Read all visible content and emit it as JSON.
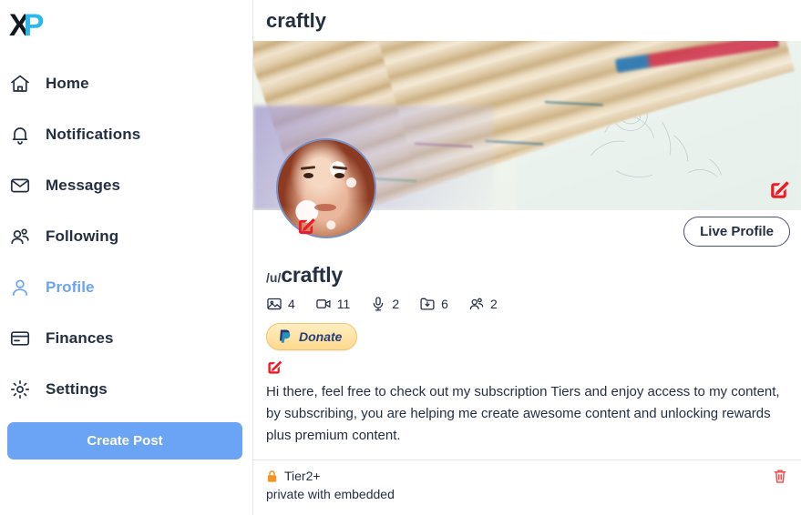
{
  "sidebar": {
    "logo": {
      "part1": "X",
      "part2": "P",
      "name": "xp-logo"
    },
    "items": [
      {
        "label": "Home",
        "icon": "home-icon",
        "active": false
      },
      {
        "label": "Notifications",
        "icon": "bell-icon",
        "active": false
      },
      {
        "label": "Messages",
        "icon": "envelope-icon",
        "active": false
      },
      {
        "label": "Following",
        "icon": "users-icon",
        "active": false
      },
      {
        "label": "Profile",
        "icon": "user-icon",
        "active": true
      },
      {
        "label": "Finances",
        "icon": "credit-card-icon",
        "active": false
      },
      {
        "label": "Settings",
        "icon": "gear-icon",
        "active": false
      }
    ],
    "create_post_label": "Create Post"
  },
  "header": {
    "title": "craftly"
  },
  "banner": {
    "edit_icon": "edit-square-icon",
    "description": "colored pencils on sketch pad"
  },
  "avatar": {
    "edit_icon": "edit-square-icon",
    "description": "portrait of woman with red hair"
  },
  "actions": {
    "live_profile_label": "Live Profile"
  },
  "profile": {
    "handle_prefix": "/u/",
    "handle_name": "craftly",
    "stats": [
      {
        "icon": "image-icon",
        "value": "4"
      },
      {
        "icon": "video-camera-icon",
        "value": "11"
      },
      {
        "icon": "microphone-icon",
        "value": "2"
      },
      {
        "icon": "folder-download-icon",
        "value": "6"
      },
      {
        "icon": "people-icon",
        "value": "2"
      }
    ],
    "donate_label": "Donate",
    "donate_icon": "paypal-icon",
    "bio_edit_icon": "edit-square-icon",
    "bio": "Hi there, feel free to check out my subscription Tiers and enjoy access to my content, by subscribing, you are helping me create awesome content and unlocking rewards plus premium content."
  },
  "tier": {
    "lock_icon": "lock-icon",
    "label": "Tier2+",
    "subtitle": "private with embedded",
    "delete_icon": "trash-icon"
  },
  "colors": {
    "accent_blue": "#6ba3f5",
    "logo_cyan": "#2bb8ef",
    "text_navy": "#242f42",
    "edit_red": "#ee1b24",
    "delete_red": "#ef4444",
    "lock_orange": "#f59323",
    "donate_bg": "#ffd98e",
    "paypal_blue": "#25407a"
  }
}
